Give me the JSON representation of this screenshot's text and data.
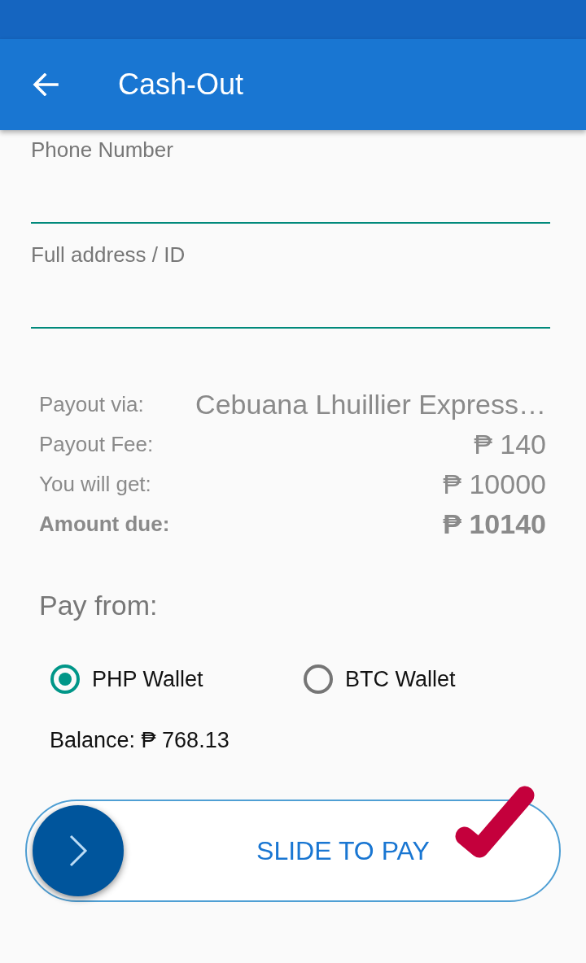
{
  "app_bar": {
    "title": "Cash-Out"
  },
  "fields": [
    {
      "label": "Phone Number"
    },
    {
      "label": "Full address / ID"
    }
  ],
  "summary": [
    {
      "label": "Payout via:",
      "value": "Cebuana Lhuillier Express…",
      "kind": "detail"
    },
    {
      "label": "Payout Fee:",
      "value": "₱ 140",
      "kind": "detail"
    },
    {
      "label": "You will get:",
      "value": "₱ 10000",
      "kind": "detail"
    },
    {
      "label": "Amount due:",
      "value": "₱ 10140",
      "kind": "total"
    }
  ],
  "pay_from": {
    "title": "Pay from:",
    "options": [
      {
        "label": "PHP Wallet",
        "selected": true
      },
      {
        "label": "BTC Wallet",
        "selected": false
      }
    ],
    "balance": "Balance: ₱ 768.13"
  },
  "slider": {
    "label": "SLIDE TO PAY",
    "level": 0
  }
}
